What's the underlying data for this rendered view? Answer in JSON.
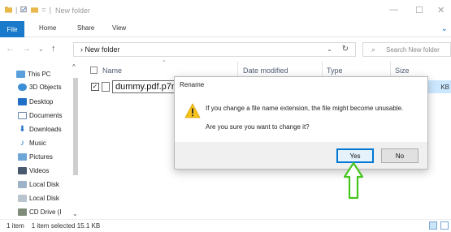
{
  "window": {
    "title": "New folder",
    "quick_access_icons": [
      "folder-icon",
      "checkbox-icon",
      "folder-icon",
      "dropdown-icon"
    ],
    "controls": {
      "minimize": "—",
      "maximize": "☐",
      "close": "✕"
    }
  },
  "ribbon": {
    "tabs": [
      "File",
      "Home",
      "Share",
      "View"
    ],
    "expand_icon": "chevron-down-icon",
    "file_tab_color": "#1979ca"
  },
  "address": {
    "path": "New folder",
    "search_placeholder": "Search New folder"
  },
  "nav_pane": {
    "items": [
      {
        "label": "This PC",
        "icon": "pc-icon"
      },
      {
        "label": "3D Objects",
        "icon": "3d-objects-icon"
      },
      {
        "label": "Desktop",
        "icon": "desktop-icon"
      },
      {
        "label": "Documents",
        "icon": "documents-icon"
      },
      {
        "label": "Downloads",
        "icon": "downloads-icon"
      },
      {
        "label": "Music",
        "icon": "music-icon"
      },
      {
        "label": "Pictures",
        "icon": "pictures-icon"
      },
      {
        "label": "Videos",
        "icon": "videos-icon"
      },
      {
        "label": "Local Disk",
        "icon": "disk-icon"
      },
      {
        "label": "Local Disk",
        "icon": "disk-icon"
      },
      {
        "label": "CD Drive (I",
        "icon": "cd-drive-icon"
      }
    ]
  },
  "columns": {
    "name": "Name",
    "date_modified": "Date modified",
    "type": "Type",
    "size": "Size"
  },
  "file": {
    "rename_value": "dummy.pdf.p7m",
    "size_fragment": "KB",
    "checked": "✓"
  },
  "dialog": {
    "title": "Rename",
    "message": "If you change a file name extension, the file might become unusable.",
    "question": "Are you sure you want to change it?",
    "yes_label": "Yes",
    "no_label": "No",
    "accent": "#0078d7"
  },
  "status": {
    "item_count": "1 item",
    "selection": "1 item selected",
    "size": "15.1 KB"
  },
  "annotation": {
    "arrow_color": "#46c51d"
  }
}
